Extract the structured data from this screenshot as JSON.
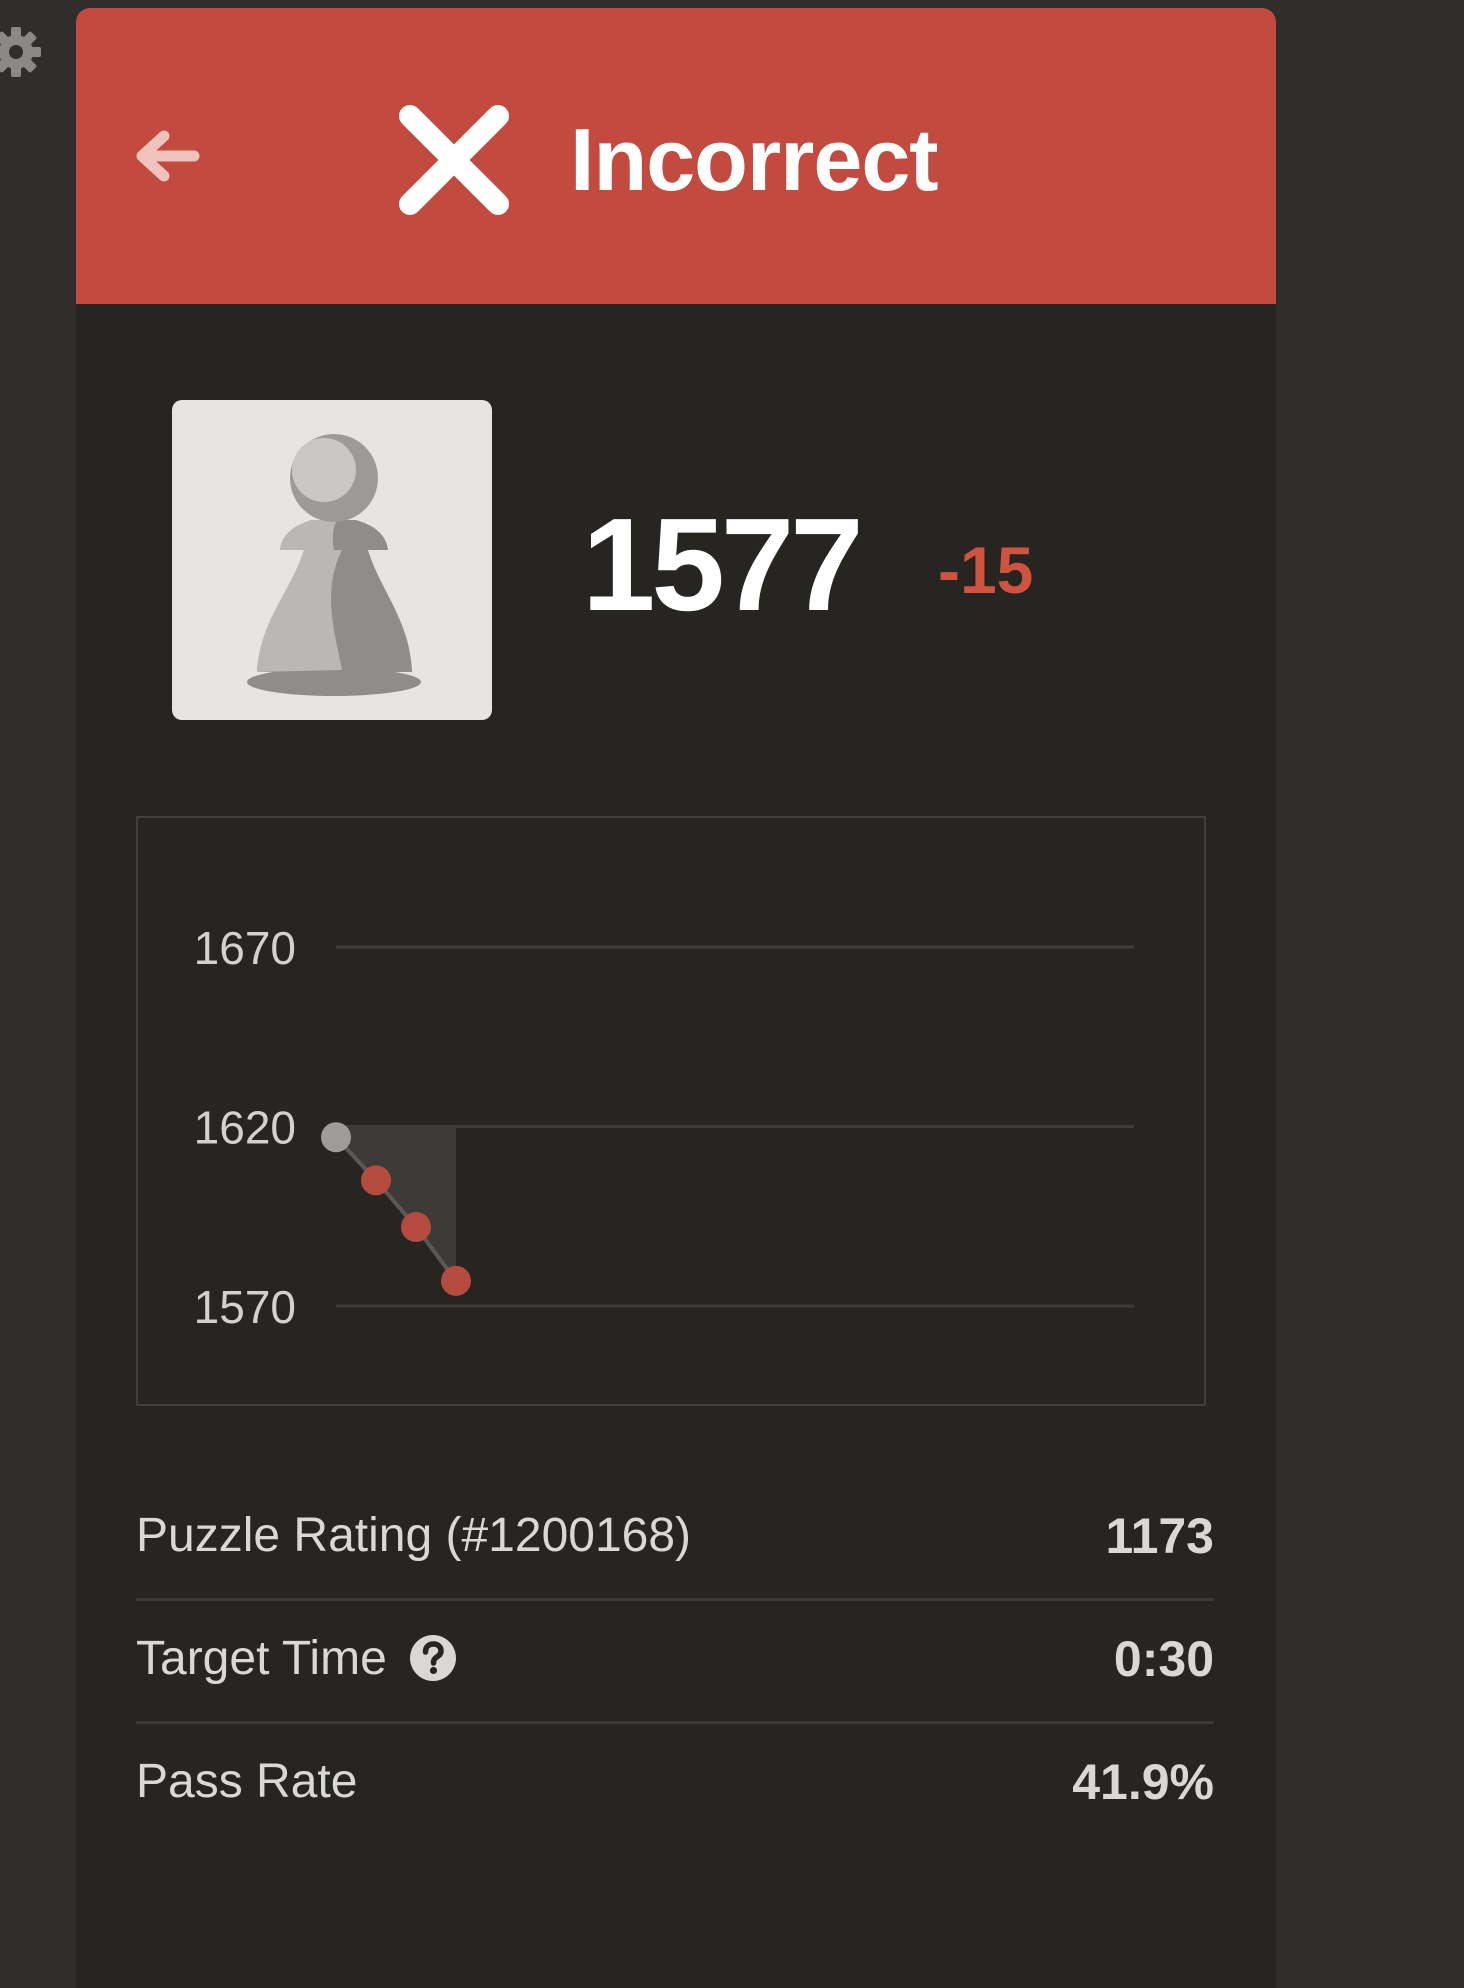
{
  "header": {
    "title": "Incorrect",
    "back_icon": "arrow-left-icon",
    "status_icon": "x-icon",
    "color": "#c24a3e"
  },
  "rating": {
    "value": "1577",
    "delta": "-15",
    "avatar_icon": "pawn-icon"
  },
  "colors": {
    "panel": "#262522",
    "incorrect": "#c24a3e",
    "point_start": "#9d9c9a",
    "point_fail": "#b54b3f"
  },
  "chart_data": {
    "type": "line",
    "y_ticks": [
      1670,
      1620,
      1570
    ],
    "ylim": [
      1570,
      1670
    ],
    "grid": true,
    "x": [
      0,
      1,
      2,
      3
    ],
    "values": [
      1617,
      1605,
      1592,
      1577
    ],
    "point_status": [
      "start",
      "fail",
      "fail",
      "fail"
    ]
  },
  "stats": {
    "puzzle_rating_label": "Puzzle Rating (#1200168)",
    "puzzle_rating_value": "1173",
    "target_time_label": "Target Time",
    "target_time_value": "0:30",
    "pass_rate_label": "Pass Rate",
    "pass_rate_value": "41.9%"
  },
  "icons": {
    "settings": "gear-icon",
    "help": "question-icon"
  }
}
